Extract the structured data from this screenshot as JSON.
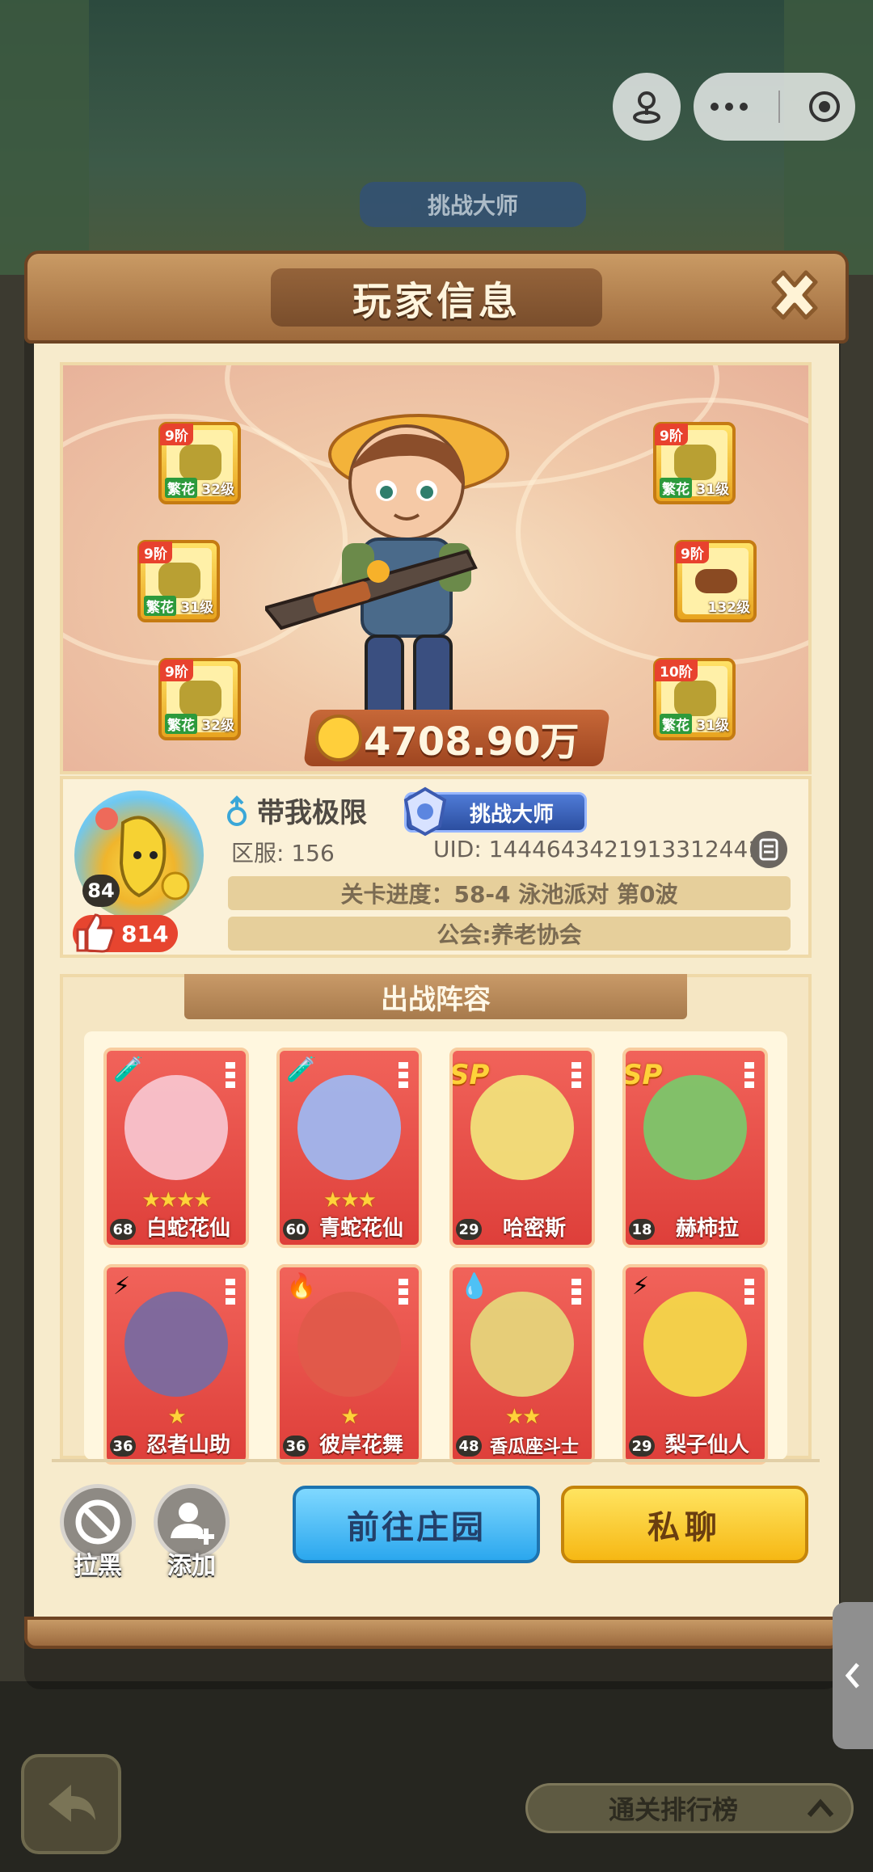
{
  "background": {
    "badge_text": "挑战大师",
    "rank_pill_label": "通关排行榜"
  },
  "dialog": {
    "title": "玩家信息",
    "close_icon": "close-icon"
  },
  "hero": {
    "equipment": [
      {
        "tier": "9阶",
        "rarity": "繁花",
        "level": "32级",
        "icon": "hat-icon"
      },
      {
        "tier": "9阶",
        "rarity": "繁花",
        "level": "31级",
        "icon": "gloves-icon"
      },
      {
        "tier": "9阶",
        "rarity": "繁花",
        "level": "32级",
        "icon": "pants-icon"
      },
      {
        "tier": "9阶",
        "rarity": "繁花",
        "level": "31级",
        "icon": "vest-icon"
      },
      {
        "tier": "9阶",
        "rarity": "",
        "level": "132级",
        "icon": "belt-icon"
      },
      {
        "tier": "10阶",
        "rarity": "繁花",
        "level": "31级",
        "icon": "boots-icon"
      }
    ],
    "power": "4708.90万"
  },
  "profile": {
    "name": "带我极限",
    "rank_badge": "挑战大师",
    "server": "区服: 156",
    "uid": "UID: 1444643421913312441",
    "level": "84",
    "likes": "814",
    "stage_progress": "关卡进度：58-4 泳池派对 第0波",
    "guild": "公会:养老协会"
  },
  "lineup": {
    "title": "出战阵容",
    "cards": [
      {
        "name": "白蛇花仙",
        "level": "68",
        "stars": "★★★★",
        "sp": "",
        "element": "🧪"
      },
      {
        "name": "青蛇花仙",
        "level": "60",
        "stars": "★★★",
        "sp": "",
        "element": "🧪"
      },
      {
        "name": "哈密斯",
        "level": "29",
        "stars": "",
        "sp": "SP",
        "element": "⚡"
      },
      {
        "name": "赫柿拉",
        "level": "18",
        "stars": "",
        "sp": "SP",
        "element": "⚡"
      },
      {
        "name": "忍者山助",
        "level": "36",
        "stars": "★",
        "sp": "",
        "element": "⚡"
      },
      {
        "name": "彼岸花舞",
        "level": "36",
        "stars": "★",
        "sp": "",
        "element": "🔥"
      },
      {
        "name": "香瓜座斗士",
        "level": "48",
        "stars": "★★",
        "sp": "",
        "element": "💧"
      },
      {
        "name": "梨子仙人",
        "level": "29",
        "stars": "",
        "sp": "",
        "element": "⚡"
      }
    ]
  },
  "actions": {
    "block_label": "拉黑",
    "add_label": "添加",
    "visit_label": "前往庄园",
    "chat_label": "私聊"
  },
  "colors": {
    "card_red": "#e5484a",
    "blue_button": "#2ba7ee",
    "yellow_button": "#f6b814",
    "wood": "#9e6a3c"
  }
}
